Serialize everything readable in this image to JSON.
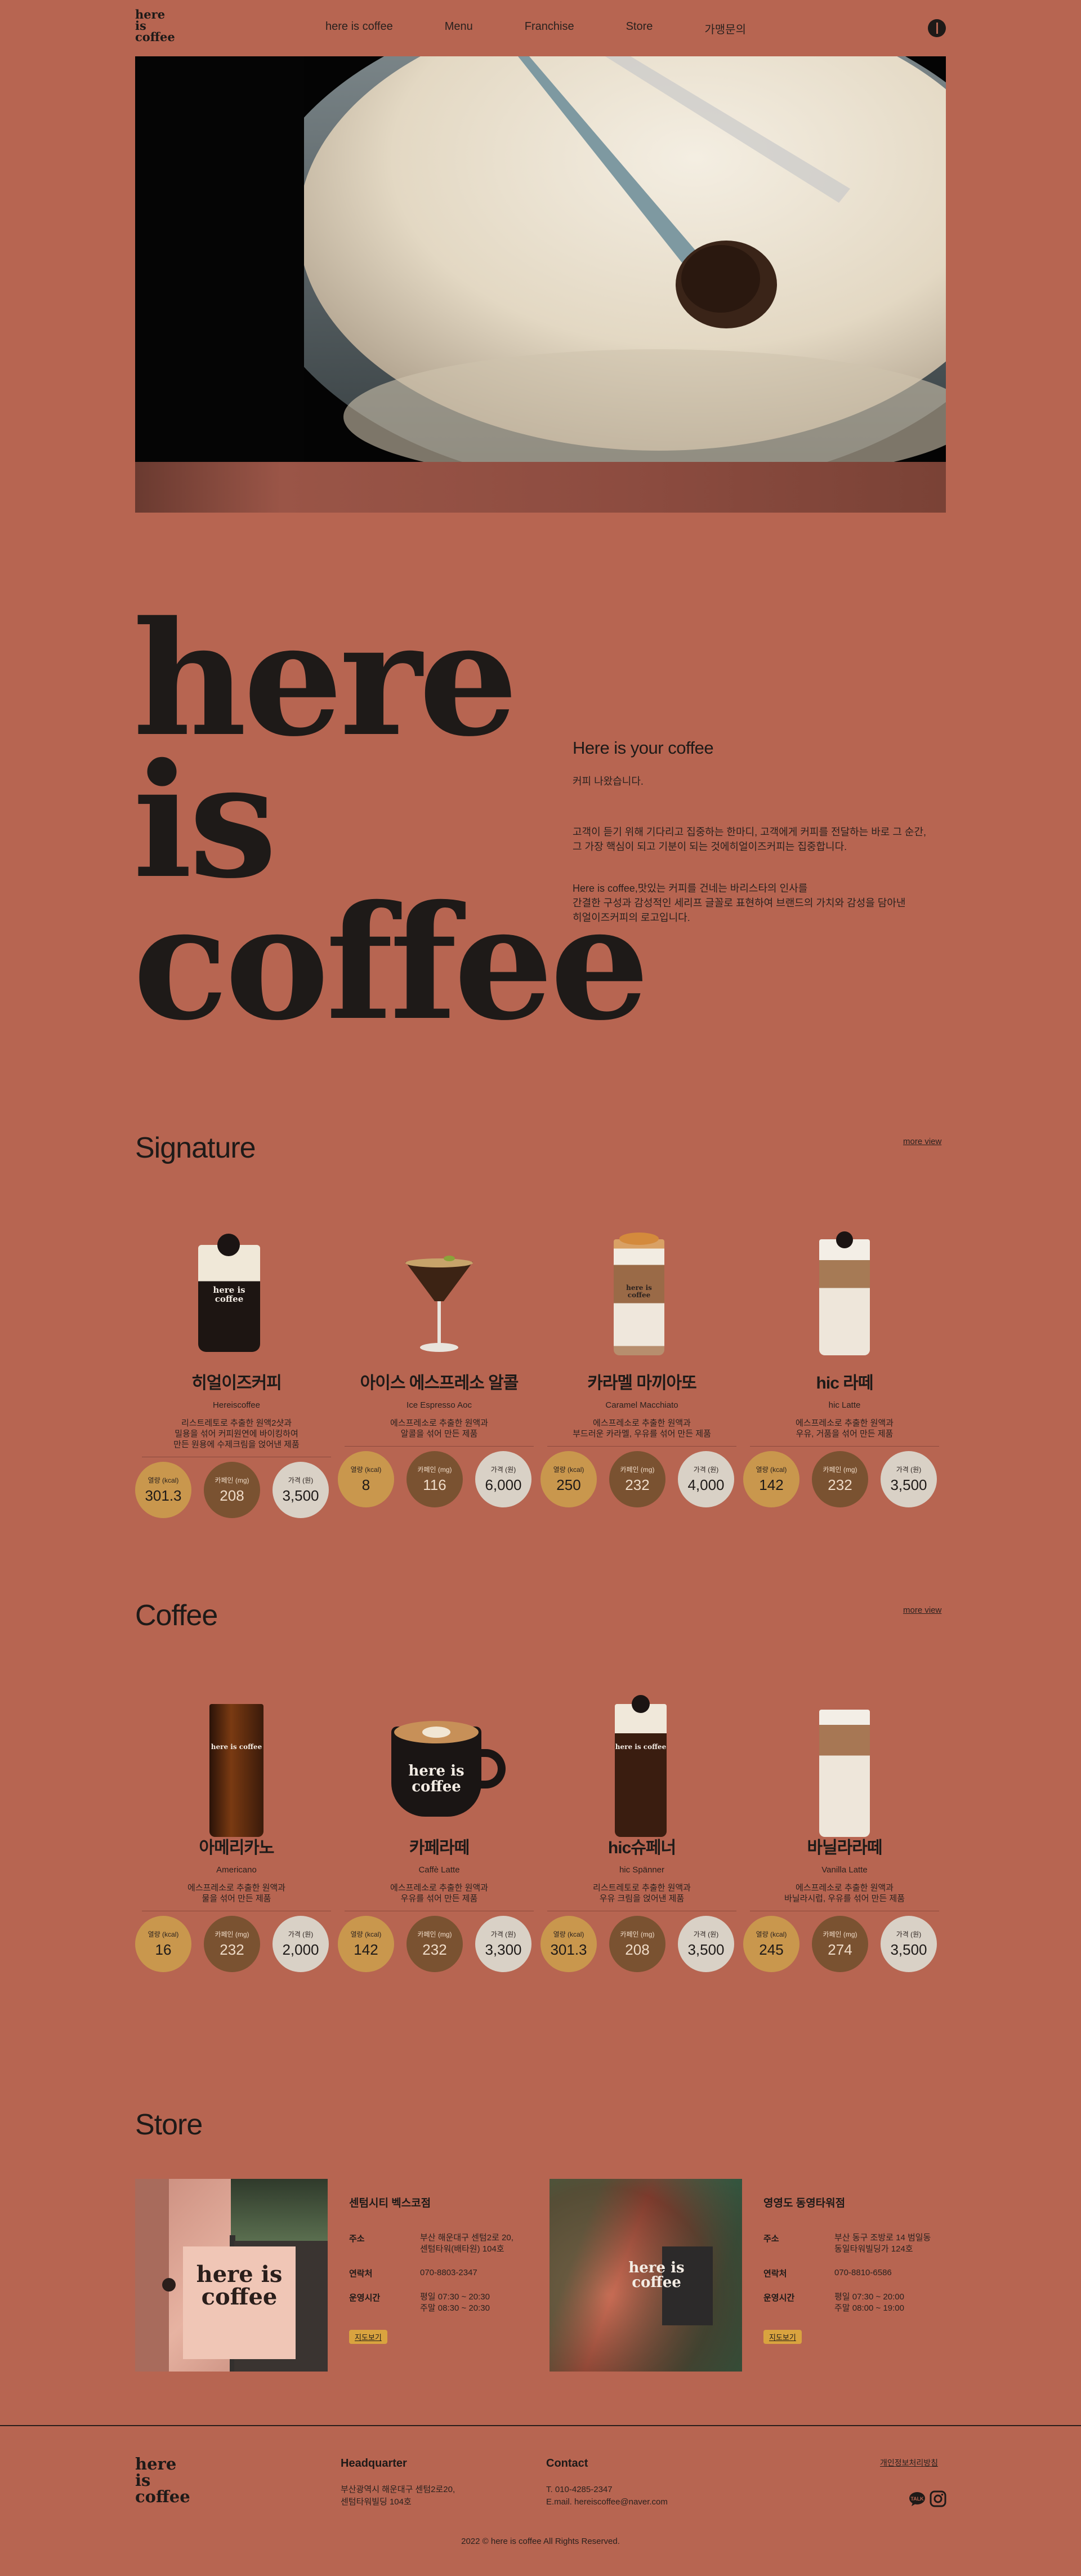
{
  "header": {
    "logo": "here\nis\ncoffee",
    "nav": [
      "here is coffee",
      "Menu",
      "Franchise",
      "Store",
      "가맹문의"
    ]
  },
  "intro": {
    "big_logo": "here\nis\ncoffee",
    "heading": "Here is your coffee",
    "p1": "커피 나왔습니다.",
    "p2": "고객이 듣기 위해 기다리고 집중하는 한마디, 고객에게 커피를 전달하는 바로 그 순간,\n그 가장 핵심이 되고 기분이 되는 것에히얼이즈커피는 집중합니다.",
    "p3": "Here is coffee,맛있는 커피를 건네는 바리스타의 인사를\n간결한 구성과 감성적인 세리프 글꼴로 표현하여 브랜드의 가치와 감성을 담아낸\n히얼이즈커피의 로고입니다."
  },
  "signature": {
    "title": "Signature",
    "more": "more view",
    "items": [
      {
        "name": "히얼이즈커피",
        "en": "Hereiscoffee",
        "desc": "리스트레토로 추출한 원액2샷과\n밀용을 섞어 커피원연에 바이킹하여\n만든 원용에 수제크림을 얹어낸 제품",
        "kcal": "301.3",
        "caffeine": "208",
        "price": "3,500"
      },
      {
        "name": "아이스 에스프레소 알콜",
        "en": "Ice Espresso Aoc",
        "desc": "에스프레소로 추출한 원액과\n알콜을 섞어 만든 제품",
        "kcal": "8",
        "caffeine": "116",
        "price": "6,000"
      },
      {
        "name": "카라멜 마끼아또",
        "en": "Caramel Macchiato",
        "desc": "에스프레소로 추출한 원액과\n부드러운 카라멜, 우유를 섞어 만든 제품",
        "kcal": "250",
        "caffeine": "232",
        "price": "4,000"
      },
      {
        "name": "hic 라떼",
        "en": "hic Latte",
        "desc": "에스프레소로 추출한 원액과\n우유, 거품을 섞어 만든 제품",
        "kcal": "142",
        "caffeine": "232",
        "price": "3,500"
      }
    ]
  },
  "coffee": {
    "title": "Coffee",
    "more": "more view",
    "items": [
      {
        "name": "아메리카노",
        "en": "Americano",
        "desc": "에스프레소로 추출한 원액과\n물을 섞어 만든 제품",
        "kcal": "16",
        "caffeine": "232",
        "price": "2,000"
      },
      {
        "name": "카페라떼",
        "en": "Caffè Latte",
        "desc": "에스프레소로 추출한 원액과\n우유를 섞어 만든 제품",
        "kcal": "142",
        "caffeine": "232",
        "price": "3,300"
      },
      {
        "name": "hic슈페너",
        "en": "hic Spänner",
        "desc": "리스트레토로 추출한 원액과\n우유 크림을 얹어낸 제품",
        "kcal": "301.3",
        "caffeine": "208",
        "price": "3,500"
      },
      {
        "name": "바닐라라떼",
        "en": "Vanilla Latte",
        "desc": "에스프레소로 추출한 원액과\n바닐라시럽, 우유를 섞어 만든 제품",
        "kcal": "245",
        "caffeine": "274",
        "price": "3,500"
      }
    ]
  },
  "stat_labels": {
    "kcal": "열량 (kcal)",
    "caffeine": "카페인 (mg)",
    "price": "가격 (원)"
  },
  "cup_logo": "here\nis\ncoffee",
  "store": {
    "title": "Store",
    "labels": {
      "address": "주소",
      "phone": "연락처",
      "hours": "운영시간",
      "map": "지도보기"
    },
    "items": [
      {
        "name": "센텀시티 벡스코점",
        "address": "부산 해운대구 센텀2로 20,\n센텀타워(배타원) 104호",
        "phone": "070-8803-2347",
        "hours": "평일 07:30 ~ 20:30\n주말 08:30 ~ 20:30"
      },
      {
        "name": "영영도 동영타워점",
        "address": "부산 동구 조방로 14 범일동\n동일타워빌딩가 124호",
        "phone": "070-8810-6586",
        "hours": "평일 07:30 ~ 20:00\n주말 08:00 ~ 19:00"
      }
    ]
  },
  "footer": {
    "logo": "here\nis\ncoffee",
    "hq_title": "Headquarter",
    "hq_text": "부산광역시 해운대구 센텀2로20,\n센텀타워빌딩 104호",
    "contact_title": "Contact",
    "contact_phone": "T. 010-4285-2347",
    "contact_email": "E.mail. hereiscoffee@naver.com",
    "privacy": "개인정보처리방침",
    "copyright": "2022 © here is coffee All Rights Reserved."
  }
}
